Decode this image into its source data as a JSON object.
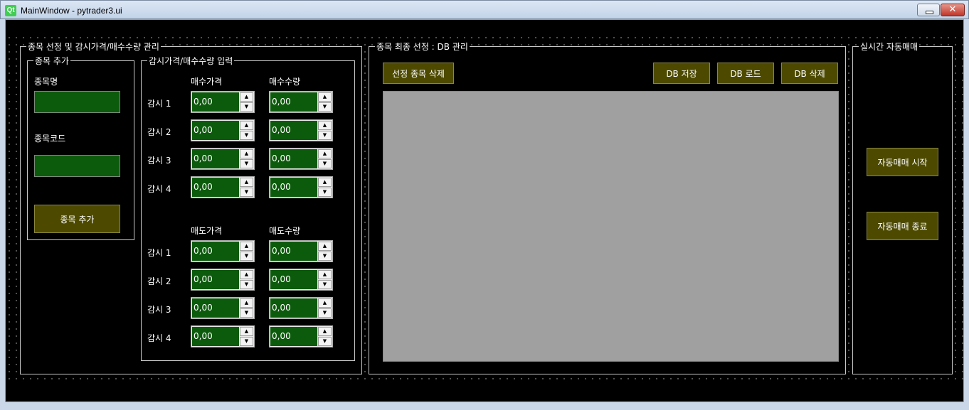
{
  "window": {
    "title": "MainWindow - pytrader3.ui",
    "logo_text": "Qt",
    "close_glyph": "✕"
  },
  "colors": {
    "input_green": "#0c5a0c",
    "button_olive": "#4d4a00",
    "table_gray": "#a0a0a0",
    "background": "#000000"
  },
  "main_group": {
    "title": "종목 선정 및 감시가격/매수수량 관리"
  },
  "add_group": {
    "title": "종목 추가",
    "name_label": "종목명",
    "name_value": "",
    "code_label": "종목코드",
    "code_value": "",
    "add_button": "종목 추가"
  },
  "watch_group": {
    "title": "감시가격/매수수량 입력",
    "buy_price_header": "매수가격",
    "buy_qty_header": "매수수량",
    "sell_price_header": "매도가격",
    "sell_qty_header": "매도수량",
    "buy_rows": [
      {
        "label": "감시 1",
        "price": "0,00",
        "qty": "0,00"
      },
      {
        "label": "감시 2",
        "price": "0,00",
        "qty": "0,00"
      },
      {
        "label": "감시 3",
        "price": "0,00",
        "qty": "0,00"
      },
      {
        "label": "감시 4",
        "price": "0,00",
        "qty": "0,00"
      }
    ],
    "sell_rows": [
      {
        "label": "감시 1",
        "price": "0,00",
        "qty": "0,00"
      },
      {
        "label": "감시 2",
        "price": "0,00",
        "qty": "0,00"
      },
      {
        "label": "감시 3",
        "price": "0,00",
        "qty": "0,00"
      },
      {
        "label": "감시 4",
        "price": "0,00",
        "qty": "0,00"
      }
    ]
  },
  "db_group": {
    "title": "종목 최종 선정 : DB 관리",
    "delete_selected_button": "선정 종목 삭제",
    "db_save_button": "DB 저장",
    "db_load_button": "DB 로드",
    "db_delete_button": "DB 삭제"
  },
  "auto_group": {
    "title": "실시간 자동매매",
    "start_button": "자동매매 시작",
    "stop_button": "자동매매 종료"
  }
}
